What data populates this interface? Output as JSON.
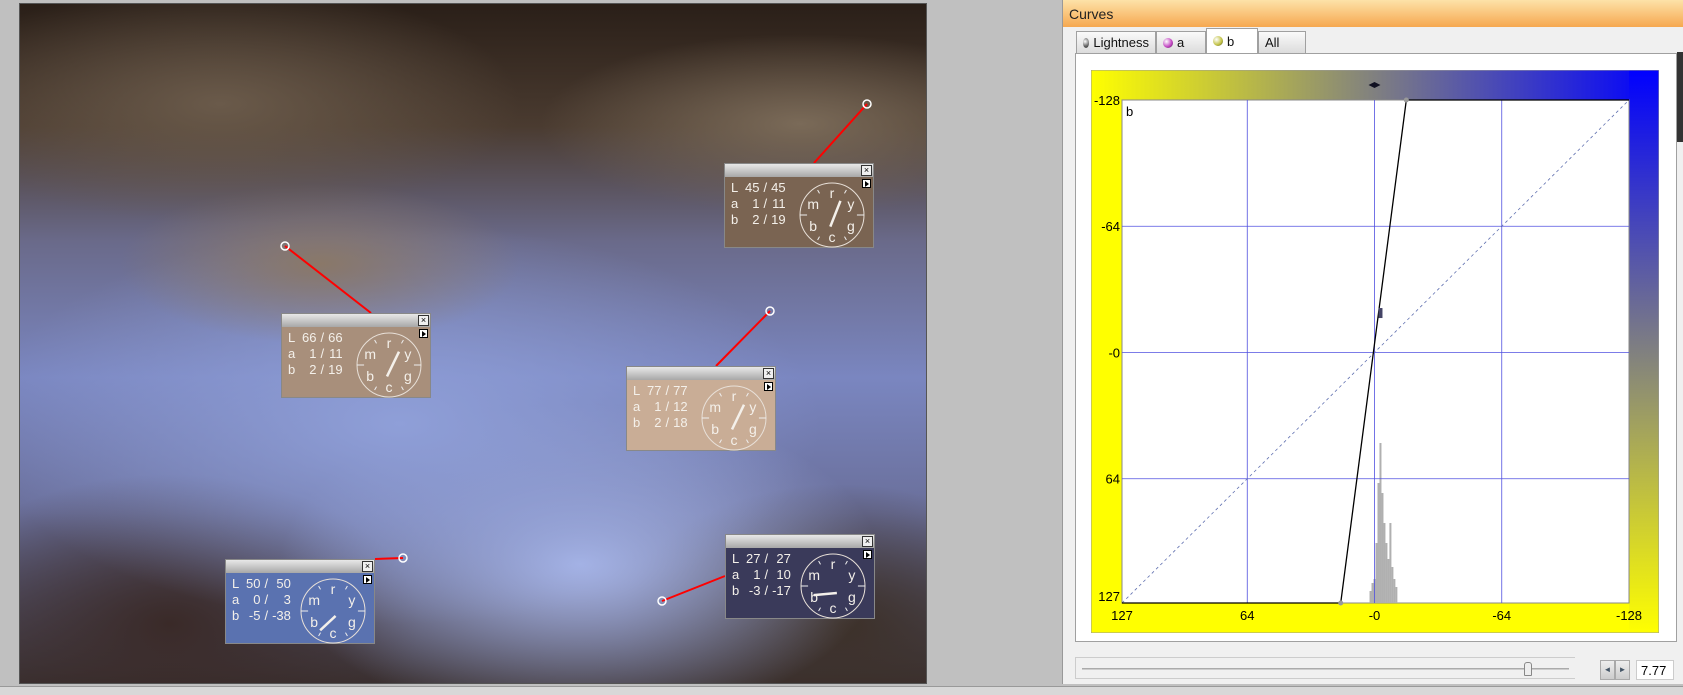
{
  "photo": {
    "samplers": [
      {
        "L": [
          "45",
          "45"
        ],
        "a": [
          "1",
          "11"
        ],
        "b": [
          "2",
          "19"
        ],
        "color": "#7a6452",
        "hue_deg": 25
      },
      {
        "L": [
          "66",
          "66"
        ],
        "a": [
          "1",
          "11"
        ],
        "b": [
          "2",
          "19"
        ],
        "color": "#a88f7b",
        "hue_deg": 30
      },
      {
        "L": [
          "77",
          "77"
        ],
        "a": [
          "1",
          "12"
        ],
        "b": [
          "2",
          "18"
        ],
        "color": "#c9ad96",
        "hue_deg": 30
      },
      {
        "L": [
          "50",
          "50"
        ],
        "a": [
          "0",
          "3"
        ],
        "b": [
          "-5",
          "-38"
        ],
        "color": "#5a72b0",
        "hue_deg": 220
      },
      {
        "L": [
          "27",
          "27"
        ],
        "a": [
          "1",
          "10"
        ],
        "b": [
          "-3",
          "-17"
        ],
        "color": "#3a3a5a",
        "hue_deg": 255
      }
    ],
    "labels": {
      "L": "L",
      "a": "a",
      "b": "b"
    },
    "clock_letters": [
      "r",
      "y",
      "g",
      "c",
      "b",
      "m"
    ],
    "close": "×",
    "pin_color": "#ff0000"
  },
  "curves": {
    "title": "Curves",
    "tabs": [
      {
        "label": "Lightness",
        "icon": "lightness-icon",
        "color": "#666666"
      },
      {
        "label": "a",
        "icon": "a-channel-icon",
        "color": "#c040c0"
      },
      {
        "label": "b",
        "icon": "b-channel-icon",
        "color": "#c0c040",
        "active": true
      },
      {
        "label": "All"
      }
    ],
    "slider": {
      "value": "7.77",
      "fraction": 0.92,
      "left": "◄",
      "right": "►"
    }
  },
  "chart_data": {
    "type": "line",
    "title": "b",
    "x_ticks": [
      "127",
      "64",
      "-0",
      "-64",
      "-128"
    ],
    "y_ticks": [
      "-128",
      "-64",
      "-0",
      "64",
      "127"
    ],
    "xlim": [
      127,
      -128
    ],
    "ylim": [
      -128,
      127
    ],
    "grid": true,
    "curve": [
      [
        127,
        127
      ],
      [
        17,
        127
      ],
      [
        -16,
        -128
      ],
      [
        -128,
        -128
      ]
    ],
    "control_point": [
      -3,
      -20
    ],
    "identity_line": true,
    "histogram": [
      [
        0,
        12
      ],
      [
        -1,
        30
      ],
      [
        -2,
        60
      ],
      [
        -3,
        80
      ],
      [
        -4,
        55
      ],
      [
        -5,
        40
      ],
      [
        -6,
        30
      ],
      [
        -7,
        22
      ],
      [
        -8,
        40
      ],
      [
        -9,
        18
      ],
      [
        -10,
        12
      ],
      [
        -11,
        8
      ],
      [
        2,
        6
      ],
      [
        1,
        10
      ]
    ],
    "colors": {
      "grid": "#5050e0",
      "curve": "#000000",
      "histogram": "#b0b0b0",
      "yellow": "#ffff00",
      "blue": "#0000ff"
    }
  }
}
